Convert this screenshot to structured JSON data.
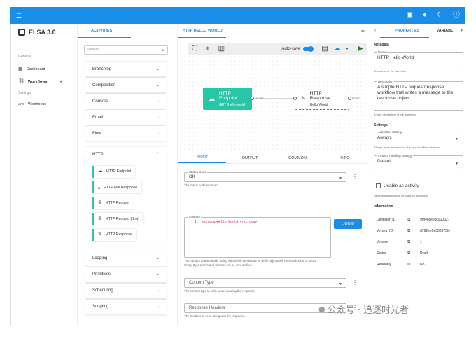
{
  "app": {
    "title": "ELSA 3.0"
  },
  "topbar": {
    "icons": [
      "file-icon",
      "github-icon",
      "dark-mode-icon",
      "info-icon"
    ]
  },
  "nav": {
    "general": "General",
    "dashboard": "Dashboard",
    "workflows": "Workflows",
    "settings": "Settings",
    "webhooks": "Webhooks",
    "http_prefix": "HTTP"
  },
  "activities": {
    "tab": "ACTIVITIES",
    "search_placeholder": "Search...",
    "categories_top": [
      "Branching",
      "Composition",
      "Console",
      "Email",
      "Flow"
    ],
    "http": {
      "label": "HTTP",
      "items": [
        "HTTP Endpoint",
        "HTTP File Response",
        "HTTP Request",
        "HTTP Request (flow)",
        "HTTP Response"
      ]
    },
    "categories_bottom": [
      "Looping",
      "Primitives",
      "Scheduling",
      "Scripting"
    ]
  },
  "designer": {
    "tab": "HTTP HELLO WORLD",
    "autosave": "Auto-save",
    "node1": {
      "title": "HTTP Endpoint",
      "sub": "GET /hello-world",
      "outcome": "Done"
    },
    "node2": {
      "title": "HTTP Response",
      "sub": "Hello World",
      "outcome": "Done"
    },
    "tabs": [
      "INPUT",
      "OUTPUT",
      "COMMON",
      "INFO"
    ],
    "status_code": {
      "label": "Status Code",
      "value": "OK",
      "hint": "The status code to return."
    },
    "content": {
      "label": "Content",
      "line": "1",
      "code": "<strong>Hello World!</strong>",
      "liquid": "LIQUID",
      "hint": "The content to write back. String values will be sent as-is, while objects will be serialized to a JSON string. Byte arrays and streams will be sent as files."
    },
    "content_type": {
      "label": "Content Type",
      "hint": "The content type to write when sending the response."
    },
    "response_headers": {
      "label": "Response Headers",
      "hint": "The headers to send along with the response."
    }
  },
  "props": {
    "tab1": "PROPERTIES",
    "tab2": "VARIABL",
    "metadata": "Metadata",
    "name": {
      "label": "Name",
      "value": "HTTP Hello World",
      "hint": "The name of the workflow."
    },
    "description": {
      "label": "Description",
      "value": "A simple HTTP request/response workflow that writes a message to the response object.",
      "hint": "A brief description of the workflow."
    },
    "settings": "Settings",
    "activation": {
      "label": "Activation strategy",
      "value": "Always",
      "hint": "Always allow the creation of a new workflow instance."
    },
    "incident": {
      "label": "Incident handling strategy",
      "value": "Default"
    },
    "usable": {
      "label": "Usable as activity",
      "hint": "Allow this workflow to be used as an activity."
    },
    "information": "Information",
    "info_rows": [
      {
        "key": "Definition ID",
        "value": "90f46ce9bc910627"
      },
      {
        "key": "Version ID",
        "value": "d792ee9e580875fe"
      },
      {
        "key": "Version",
        "value": "1"
      },
      {
        "key": "Status",
        "value": "Draft"
      },
      {
        "key": "Readonly",
        "value": "No"
      }
    ]
  },
  "watermark": "公众号 · 追逐时光者",
  "colors": {
    "primary": "#1a8ee6",
    "node_teal": "#26c6a6",
    "selected_border": "#e53935"
  }
}
